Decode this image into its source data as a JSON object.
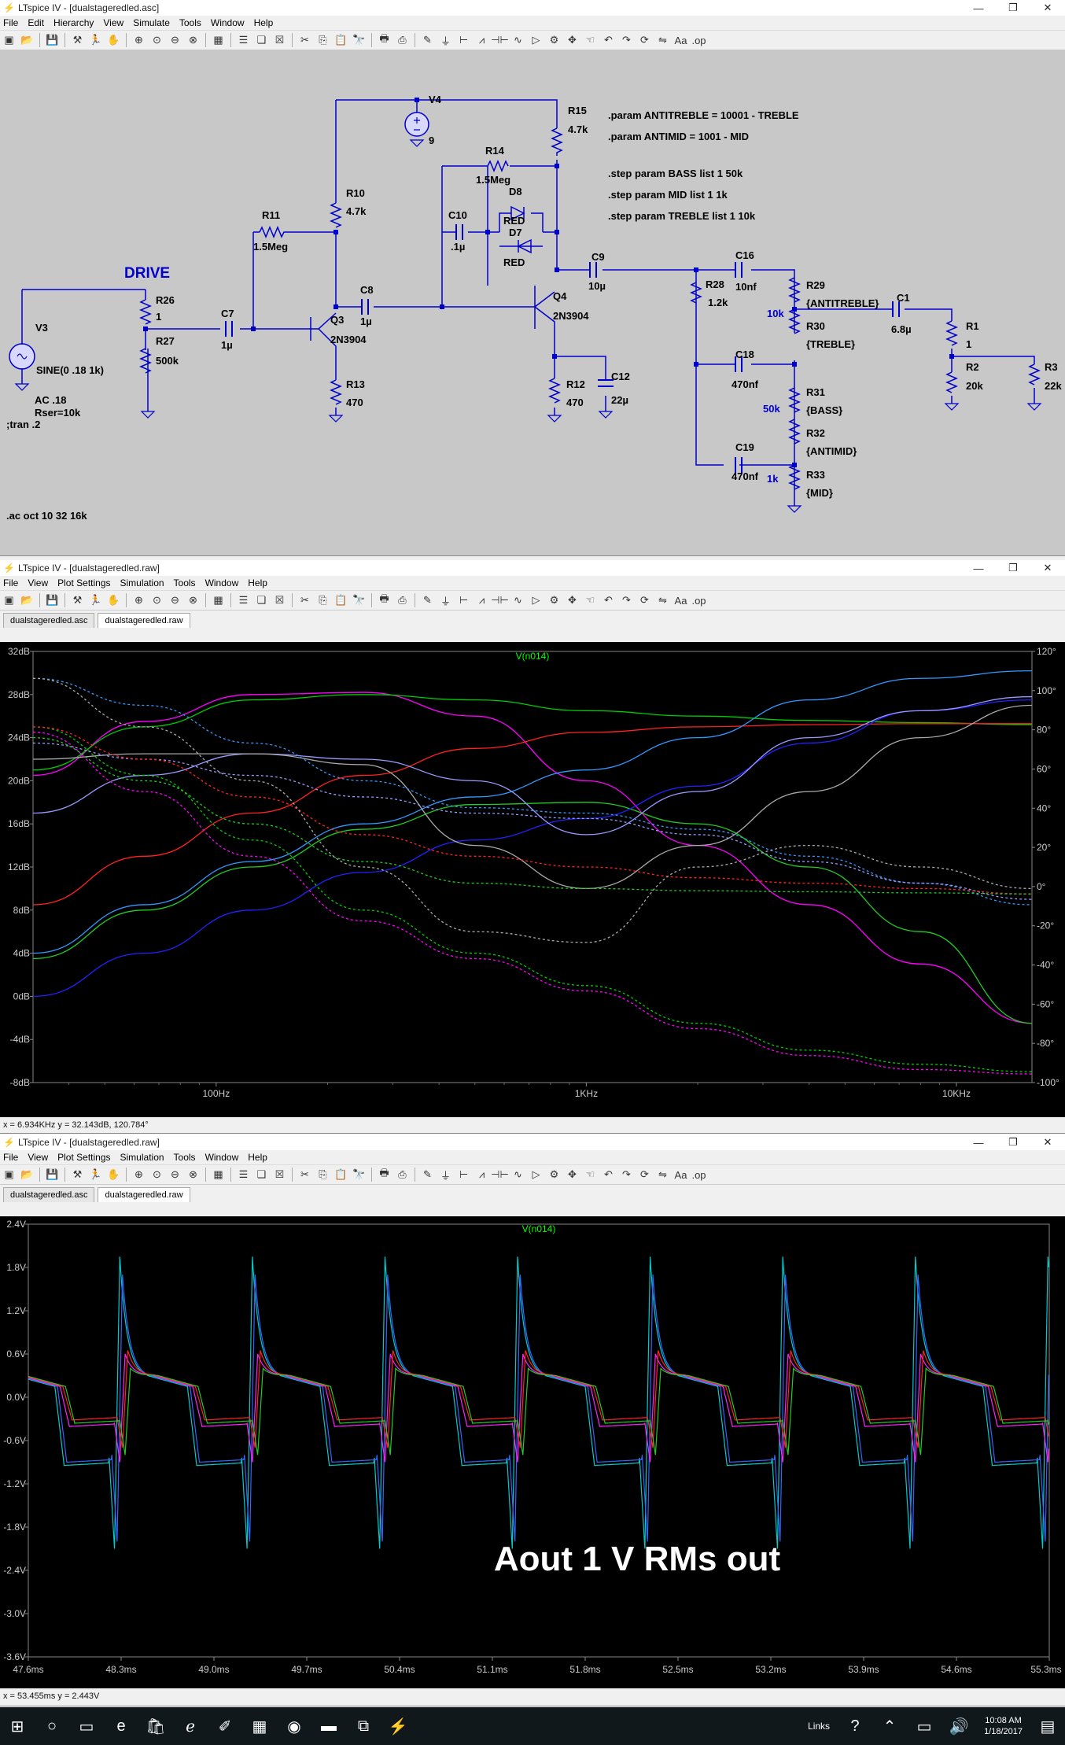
{
  "win1": {
    "title": "LTspice IV - [dualstageredled.asc]",
    "menu": [
      "File",
      "Edit",
      "Hierarchy",
      "View",
      "Simulate",
      "Tools",
      "Window",
      "Help"
    ],
    "schematic": {
      "params": [
        ".param ANTITREBLE = 10001 - TREBLE",
        ".param ANTIMID = 1001 - MID",
        ".step param BASS list 1 50k",
        ".step param MID list 1 1k",
        ".step param TREBLE list 1 10k"
      ],
      "drive_label": "DRIVE",
      "ac_directive": ".ac oct 10 32 16k",
      "tran_directive": ";tran .2",
      "source_text": [
        "SINE(0 .18 1k)",
        "AC .18",
        "Rser=10k"
      ],
      "components": {
        "V3": "V3",
        "V4": "V4",
        "V4_val": "9",
        "R26": "R26",
        "R26_val": "1",
        "R27": "R27",
        "R27_val": "500k",
        "C7": "C7",
        "C7_val": "1µ",
        "R11": "R11",
        "R11_val": "1.5Meg",
        "R10": "R10",
        "R10_val": "4.7k",
        "Q3": "Q3",
        "Q3_val": "2N3904",
        "R13": "R13",
        "R13_val": "470",
        "C8": "C8",
        "C8_val": "1µ",
        "C10": "C10",
        "C10_val": ".1µ",
        "R14": "R14",
        "R14_val": "1.5Meg",
        "D8": "D8",
        "D8_val": "RED",
        "D7": "D7",
        "D7_val": "RED",
        "R15": "R15",
        "R15_val": "4.7k",
        "Q4": "Q4",
        "Q4_val": "2N3904",
        "R12": "R12",
        "R12_val": "470",
        "C12": "C12",
        "C12_val": "22µ",
        "C9": "C9",
        "C9_val": "10µ",
        "R28": "R28",
        "R28_val": "1.2k",
        "C16": "C16",
        "C16_val": "10nf",
        "C18": "C18",
        "C18_val": "470nf",
        "C19": "C19",
        "C19_val": "470nf",
        "R29": "R29",
        "R29_val": "{ANTITREBLE}",
        "R30": "R30",
        "R30_val": "{TREBLE}",
        "R31": "R31",
        "R31_val": "{BASS}",
        "R32": "R32",
        "R32_val": "{ANTIMID}",
        "R33": "R33",
        "R33_val": "{MID}",
        "lbl10k": "10k",
        "lbl50k": "50k",
        "lbl1k": "1k",
        "C1": "C1",
        "C1_val": "6.8µ",
        "R1": "R1",
        "R1_val": "1",
        "R2": "R2",
        "R2_val": "20k",
        "R3": "R3",
        "R3_val": "22k"
      }
    }
  },
  "win2": {
    "title": "LTspice IV - [dualstageredled.raw]",
    "menu": [
      "File",
      "View",
      "Plot Settings",
      "Simulation",
      "Tools",
      "Window",
      "Help"
    ],
    "tabs": [
      "dualstageredled.asc",
      "dualstageredled.raw"
    ],
    "status": "x = 6.934KHz    y = 32.143dB, 120.784°"
  },
  "win3": {
    "title": "LTspice IV - [dualstageredled.raw]",
    "menu": [
      "File",
      "View",
      "Plot Settings",
      "Simulation",
      "Tools",
      "Window",
      "Help"
    ],
    "tabs": [
      "dualstageredled.asc",
      "dualstageredled.raw"
    ],
    "status": "x = 53.455ms    y = 2.443V",
    "overlay_text": "Aout 1 V RMs out"
  },
  "chart_data": [
    {
      "type": "line",
      "title": "V(n014)",
      "x_scale": "log",
      "xlim": [
        32,
        16000
      ],
      "ylim": [
        -8,
        32
      ],
      "y2lim": [
        -100,
        120
      ],
      "x_ticks": [
        "100Hz",
        "1KHz",
        "10KHz"
      ],
      "y_ticks": [
        "32dB",
        "28dB",
        "24dB",
        "20dB",
        "16dB",
        "12dB",
        "8dB",
        "4dB",
        "0dB",
        "-4dB",
        "-8dB"
      ],
      "y2_ticks": [
        "120°",
        "100°",
        "80°",
        "60°",
        "40°",
        "20°",
        "0°",
        "-20°",
        "-40°",
        "-60°",
        "-80°",
        "-100°"
      ],
      "x": [
        32,
        64,
        125,
        250,
        500,
        1000,
        2000,
        4000,
        8000,
        16000
      ],
      "series": [
        {
          "color": "#ff00ff",
          "style": "solid",
          "values": [
            20.5,
            25.5,
            28,
            28.2,
            26,
            20,
            14,
            8.5,
            3,
            -2.5
          ]
        },
        {
          "color": "#00cc00",
          "style": "solid",
          "values": [
            21,
            25,
            27.5,
            28,
            27.5,
            26.5,
            26,
            25.6,
            25.4,
            25.2
          ]
        },
        {
          "color": "#ff2222",
          "style": "solid",
          "values": [
            8.5,
            13,
            17,
            20.5,
            23,
            24.5,
            25,
            25.2,
            25.3,
            25.3
          ]
        },
        {
          "color": "#3399ff",
          "style": "solid",
          "values": [
            4,
            8.5,
            12.5,
            16,
            18.5,
            21,
            24,
            27.5,
            29.5,
            30.2
          ]
        },
        {
          "color": "#22cc22",
          "style": "solid",
          "values": [
            3.5,
            8,
            12,
            15.5,
            17.8,
            18,
            16,
            12,
            6,
            -2.5
          ]
        },
        {
          "color": "#2222ff",
          "style": "solid",
          "values": [
            0,
            4,
            8,
            11.5,
            14.5,
            16.5,
            19.5,
            23.5,
            26.5,
            27.5
          ]
        },
        {
          "color": "#9999ff",
          "style": "solid",
          "values": [
            17,
            20.5,
            22.5,
            22,
            20,
            15,
            19,
            24,
            26.5,
            27.8
          ]
        },
        {
          "color": "#aaaaaa",
          "style": "solid",
          "values": [
            22,
            22.5,
            22.5,
            21.5,
            14,
            10,
            14,
            19,
            24,
            27
          ]
        },
        {
          "color": "#ff00ff",
          "style": "dot",
          "values": [
            24.5,
            19,
            13,
            7,
            3.5,
            0.5,
            -3,
            -5.5,
            -6.8,
            -7.2
          ]
        },
        {
          "color": "#00cc00",
          "style": "dot",
          "values": [
            25,
            20.5,
            14.5,
            8,
            4,
            1,
            -2.5,
            -5,
            -6.3,
            -7
          ]
        },
        {
          "color": "#3399ff",
          "style": "dot",
          "values": [
            29.5,
            27,
            23.5,
            20,
            17.5,
            17,
            15.5,
            13,
            10.5,
            8.5
          ]
        },
        {
          "color": "#9999ff",
          "style": "dot",
          "values": [
            23.5,
            22,
            20.5,
            18.5,
            17,
            16.5,
            15,
            12.5,
            10.5,
            9
          ]
        },
        {
          "color": "#ff2222",
          "style": "dot",
          "values": [
            25,
            22,
            18.5,
            15,
            13,
            12,
            11,
            10.5,
            10,
            9.5
          ]
        },
        {
          "color": "#22cc22",
          "style": "dot",
          "values": [
            24,
            20,
            16,
            12.5,
            10.5,
            10,
            9.8,
            9.7,
            9.6,
            9.5
          ]
        },
        {
          "color": "#aaaaaa",
          "style": "dot",
          "values": [
            29.5,
            25,
            20,
            12,
            6,
            5,
            12,
            14,
            12,
            10
          ]
        }
      ]
    },
    {
      "type": "line",
      "title": "V(n014)",
      "xlim": [
        47.6,
        55.3
      ],
      "ylim": [
        -3.6,
        2.4
      ],
      "x_ticks": [
        "47.6ms",
        "48.3ms",
        "49.0ms",
        "49.7ms",
        "50.4ms",
        "51.1ms",
        "51.8ms",
        "52.5ms",
        "53.2ms",
        "53.9ms",
        "54.6ms",
        "55.3ms"
      ],
      "y_ticks": [
        "2.4V",
        "1.8V",
        "1.2V",
        "0.6V",
        "0.0V",
        "-0.6V",
        "-1.2V",
        "-1.8V",
        "-2.4V",
        "-3.0V",
        "-3.6V"
      ],
      "period_ms": 1.0,
      "series": [
        {
          "color": "#00cccc",
          "peak": 1.95,
          "trough": -2.1
        },
        {
          "color": "#3366ff",
          "peak": 1.7,
          "trough": -2.0
        },
        {
          "color": "#ff22ff",
          "peak": 0.6,
          "trough": -0.9
        },
        {
          "color": "#ff2222",
          "peak": 0.65,
          "trough": -0.7
        },
        {
          "color": "#22cc22",
          "peak": 0.4,
          "trough": -0.8
        }
      ]
    }
  ]
}
